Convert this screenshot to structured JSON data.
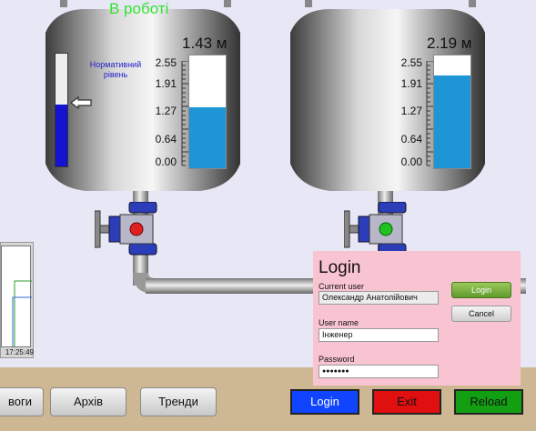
{
  "tanks": [
    {
      "status_title": "В роботі",
      "level_readout": "1.43 м",
      "norm_label": "Нормативний рівень",
      "scale_ticks": [
        "2.55",
        "1.91",
        "1.27",
        "0.64",
        "0.00"
      ],
      "fill_value": 1.43,
      "scale_max": 2.55,
      "valve_color": "#e02020"
    },
    {
      "level_readout": "2.19 м",
      "scale_ticks": [
        "2.55",
        "1.91",
        "1.27",
        "0.64",
        "0.00"
      ],
      "fill_value": 2.19,
      "scale_max": 2.55,
      "valve_color": "#22c022"
    }
  ],
  "left_gauge": {
    "fill_fraction": 0.55
  },
  "mini_chart": {
    "time_label": "17:25:49"
  },
  "nav_buttons": [
    "воги",
    "Архів",
    "Тренди"
  ],
  "commands": {
    "login": {
      "label": "Login",
      "bg": "#1144ff",
      "fg": "#ffffff"
    },
    "exit": {
      "label": "Exit",
      "bg": "#e01010",
      "fg": "#111111"
    },
    "reload": {
      "label": "Reload",
      "bg": "#12a012",
      "fg": "#111111"
    }
  },
  "login_dialog": {
    "title": "Login",
    "current_user_label": "Current user",
    "current_user_value": "Олександр Анатолійович",
    "username_label": "User name",
    "username_value": "Інженер",
    "password_label": "Password",
    "password_value": "●●●●●●●",
    "login_button": "Login",
    "cancel_button": "Cancel"
  }
}
